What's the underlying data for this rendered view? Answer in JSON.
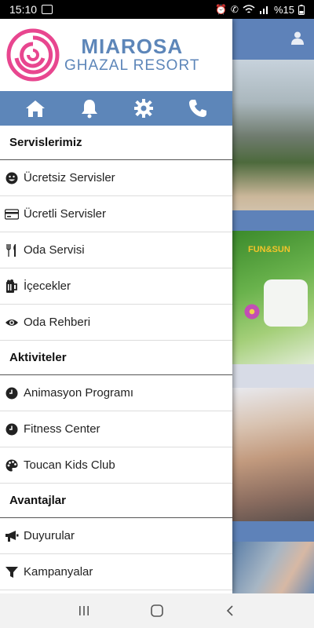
{
  "status_bar": {
    "time": "15:10",
    "battery": "%15"
  },
  "logo": {
    "title": "MIAROSA",
    "subtitle": "GHAZAL RESORT"
  },
  "icon_bar": [
    "home-icon",
    "bell-icon",
    "gear-icon",
    "phone-icon"
  ],
  "menu": {
    "section1": {
      "title": "Servislerimiz",
      "items": [
        {
          "label": "Ücretsiz Servisler",
          "icon": "smiley-icon"
        },
        {
          "label": "Ücretli Servisler",
          "icon": "credit-card-icon"
        },
        {
          "label": "Oda Servisi",
          "icon": "cutlery-icon"
        },
        {
          "label": "İçecekler",
          "icon": "beer-mug-icon"
        },
        {
          "label": "Oda Rehberi",
          "icon": "eye-icon"
        }
      ]
    },
    "section2": {
      "title": "Aktiviteler",
      "items": [
        {
          "label": "Animasyon Programı",
          "icon": "clock-icon"
        },
        {
          "label": "Fitness Center",
          "icon": "clock-icon"
        },
        {
          "label": "Toucan Kids Club",
          "icon": "palette-icon"
        }
      ]
    },
    "section3": {
      "title": "Avantajlar",
      "items": [
        {
          "label": "Duyurular",
          "icon": "megaphone-icon"
        },
        {
          "label": "Kampanyalar",
          "icon": "filter-icon"
        }
      ]
    }
  },
  "background": {
    "card_logo": "FUN&SUN"
  },
  "colors": {
    "brand_blue": "#5d86b9",
    "logo_pink": "#e8468f"
  }
}
